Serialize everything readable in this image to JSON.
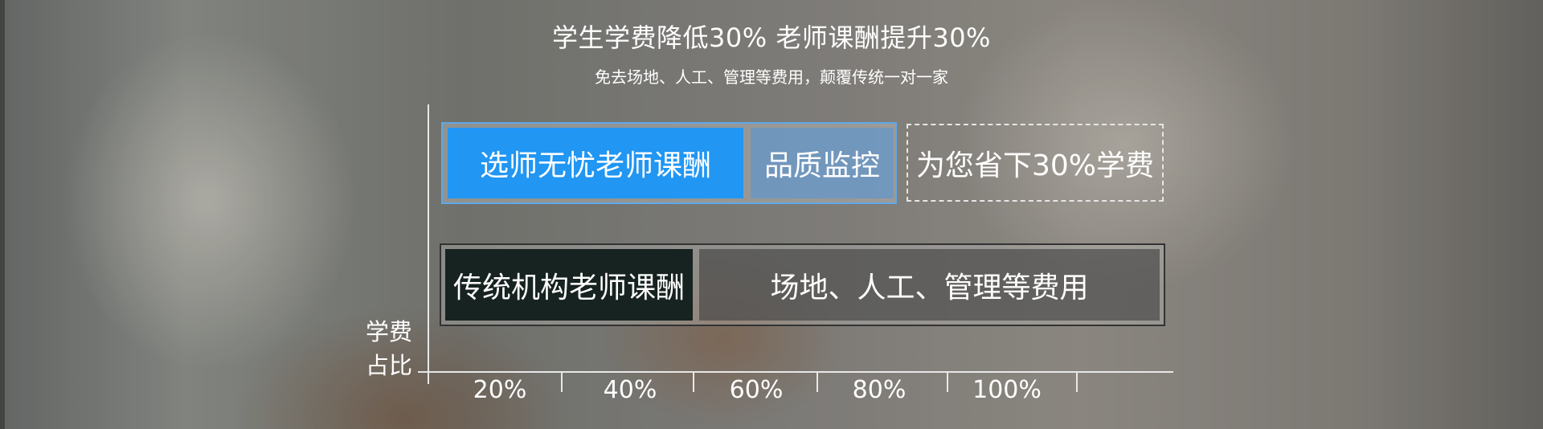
{
  "header": {
    "title": "学生学费降低30% 老师课酬提升30%",
    "subtitle": "免去场地、人工、管理等费用，颠覆传统一对一家"
  },
  "chart_data": {
    "type": "bar",
    "orientation": "horizontal",
    "stacked": true,
    "title": "学生学费降低30% 老师课酬提升30%",
    "subtitle": "免去场地、人工、管理等费用，颠覆传统一对一家",
    "ylabel": "学费占比",
    "xlabel": "",
    "x_ticks": [
      "20%",
      "40%",
      "60%",
      "80%",
      "100%"
    ],
    "series": [
      {
        "segments": [
          {
            "label": "选师无忧老师课酬",
            "color": "#2196f3"
          },
          {
            "label": "品质监控",
            "color": "#6aa8dd"
          },
          {
            "label": "为您省下30%学费",
            "color": "#ffffff",
            "style": "dashed"
          }
        ]
      },
      {
        "segments": [
          {
            "label": "传统机构老师课酬",
            "color": "#172320"
          },
          {
            "label": "场地、人工、管理等费用",
            "color": "#4a4a4a"
          }
        ]
      }
    ],
    "grid": false,
    "legend": "none"
  }
}
